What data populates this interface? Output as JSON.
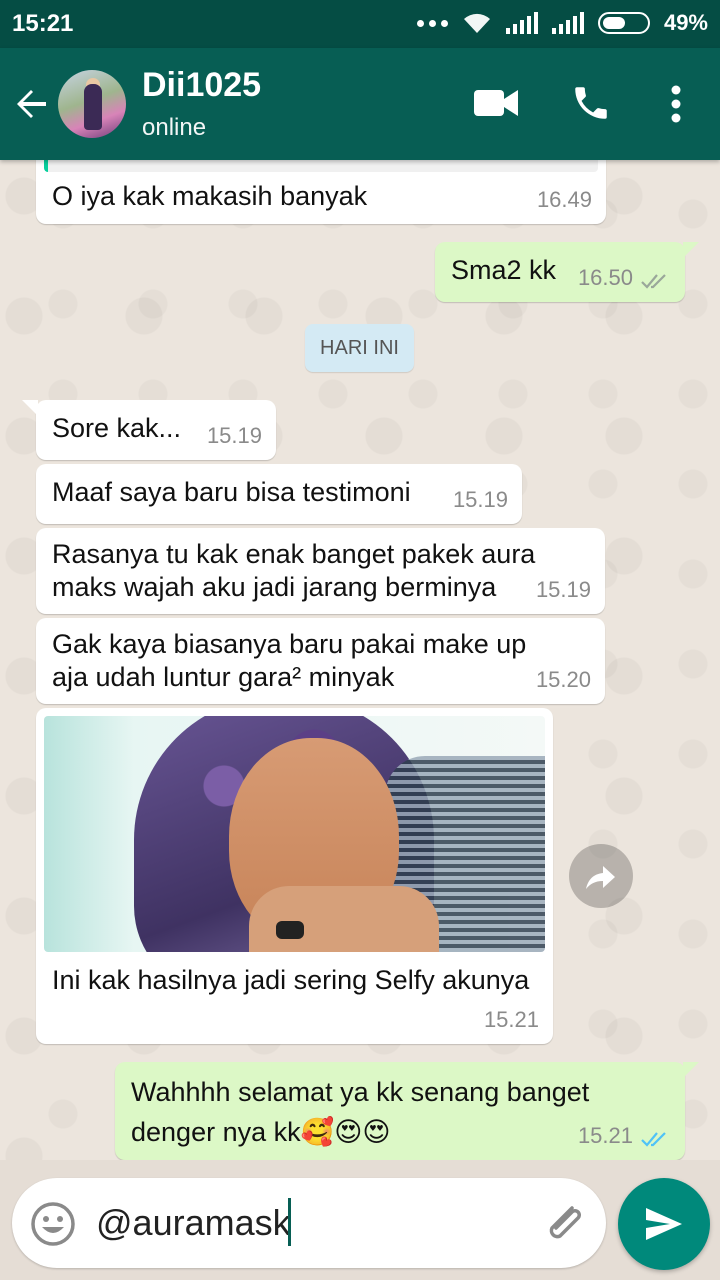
{
  "status_bar": {
    "time": "15:21",
    "battery": "49%"
  },
  "header": {
    "contact_name": "Dii1025",
    "presence": "online"
  },
  "chat": {
    "day_separator": "HARI INI",
    "messages": [
      {
        "text": "O iya kak makasih banyak",
        "time": "16.49",
        "direction": "in"
      },
      {
        "text": "Sma2 kk",
        "time": "16.50",
        "direction": "out",
        "status": "delivered"
      },
      {
        "text": "Sore kak...",
        "time": "15.19",
        "direction": "in"
      },
      {
        "text": "Maaf saya baru bisa testimoni",
        "time": "15.19",
        "direction": "in"
      },
      {
        "text": "Rasanya tu kak enak banget pakek aura maks wajah aku jadi jarang berminya",
        "time": "15.19",
        "direction": "in"
      },
      {
        "text": "Gak kaya biasanya baru pakai make up aja udah luntur gara² minyak",
        "time": "15.20",
        "direction": "in"
      },
      {
        "text": "Ini kak hasilnya jadi sering Selfy akunya",
        "time": "15.21",
        "direction": "in",
        "has_image": true
      },
      {
        "text": "Wahhhh selamat ya kk senang banget denger nya kk🥰😍😍",
        "time": "15.21",
        "direction": "out",
        "status": "read"
      }
    ]
  },
  "composer": {
    "value": "@auramask"
  },
  "colors": {
    "header": "#075e54",
    "statusbar": "#054d44",
    "outgoing_bubble": "#dcf8c6",
    "read_ticks": "#4fc3f7",
    "send_button": "#00897b"
  }
}
